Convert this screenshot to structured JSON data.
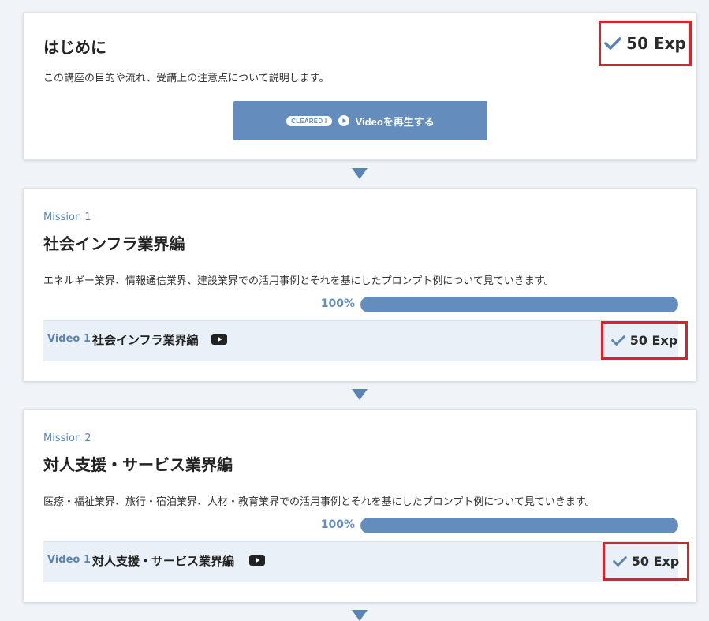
{
  "intro": {
    "title": "はじめに",
    "exp": "50 Exp",
    "description": "この講座の目的や流れ、受講上の注意点について説明します。",
    "cleared_badge": "CLEARED !",
    "video_button_label": "Videoを再生する"
  },
  "missions": [
    {
      "label": "Mission 1",
      "title": "社会インフラ業界編",
      "description": "エネルギー業界、情報通信業界、建設業界での活用事例とそれを基にしたプロンプト例について見ていきます。",
      "progress_label": "100%",
      "progress_value": 1.0,
      "video": {
        "number": "Video 1",
        "title": "社会インフラ業界編",
        "exp": "50 Exp"
      }
    },
    {
      "label": "Mission 2",
      "title": "対人支援・サービス業界編",
      "description": "医療・福祉業界、旅行・宿泊業界、人材・教育業界での活用事例とそれを基にしたプロンプト例について見ていきます。",
      "progress_label": "100%",
      "progress_value": 1.0,
      "video": {
        "number": "Video 1",
        "title": "対人支援・サービス業界編",
        "exp": "50 Exp"
      }
    }
  ],
  "colors": {
    "accent": "#648dbe",
    "highlight": "#e31e24",
    "row_bg": "#eaf0f7"
  },
  "icons": {
    "check": "check-icon",
    "play": "play-icon",
    "video": "youtube-icon",
    "connector": "down-triangle-icon"
  }
}
